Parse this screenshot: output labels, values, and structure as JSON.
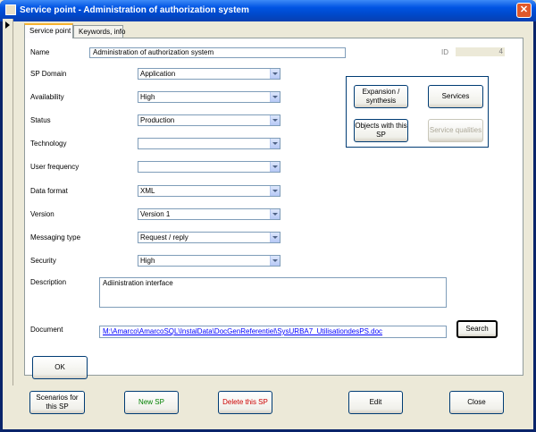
{
  "window": {
    "title": "Service point - Administration of authorization system",
    "close_glyph": "✕"
  },
  "tabs": [
    {
      "label": "Service point"
    },
    {
      "label": "Keywords, info"
    }
  ],
  "form": {
    "name_label": "Name",
    "name_value": "Administration of authorization system",
    "id_label": "ID",
    "id_value": "4",
    "fields": [
      {
        "label": "SP Domain",
        "value": "Application"
      },
      {
        "label": "Availability",
        "value": "High"
      },
      {
        "label": "Status",
        "value": "Production"
      },
      {
        "label": "Technology",
        "value": ""
      },
      {
        "label": "User frequency",
        "value": ""
      },
      {
        "label": "Data format",
        "value": "XML"
      },
      {
        "label": "Version",
        "value": "Version 1"
      },
      {
        "label": "Messaging type",
        "value": "Request / reply"
      },
      {
        "label": "Security",
        "value": "High"
      }
    ],
    "description_label": "Description",
    "description_value": "Adiinistration interface",
    "document_label": "Document",
    "document_value": "M:\\Amarco\\AmarcoSQL\\InstalData\\DocGenReferentiel\\SysURBA7_UtilisationdesPS.doc",
    "search_button": "Search",
    "ok_button": "OK"
  },
  "group_buttons": {
    "expansion": "Expansion / synthesis",
    "services": "Services",
    "objects": "Objects with this SP",
    "qualities": "Service qualities"
  },
  "footer": {
    "scenarios": "Scenarios for this SP",
    "new_sp": "New SP",
    "delete_sp": "Delete this SP",
    "edit": "Edit",
    "close": "Close"
  }
}
